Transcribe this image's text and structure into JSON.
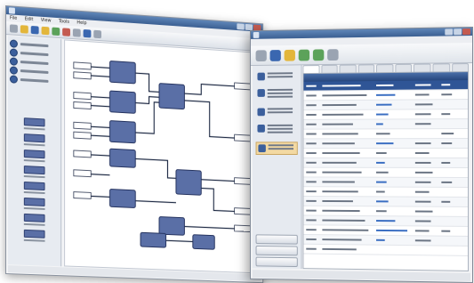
{
  "back_window": {
    "title": "",
    "menu": [
      "File",
      "Edit",
      "View",
      "Tools",
      "Help"
    ],
    "toolbar_icons": [
      "new-icon",
      "open-icon",
      "save-icon",
      "folder-icon",
      "run-icon",
      "stop-icon",
      "settings-icon"
    ],
    "nav_items": 7,
    "palette_items": 8
  },
  "front_window": {
    "title": "",
    "toolbar_icons": [
      "connect-icon",
      "device-icon",
      "refresh-icon",
      "play-icon",
      "pause-icon",
      "settings-icon"
    ],
    "left_items": 5,
    "buttons": [
      "",
      "",
      ""
    ],
    "tabs": 9,
    "table_rows": 18,
    "selected_row": 0
  },
  "colors": {
    "accent": "#2f5596",
    "header": "#26467d",
    "block": "#5a6fa6",
    "highlight": "#f3d9a2"
  }
}
